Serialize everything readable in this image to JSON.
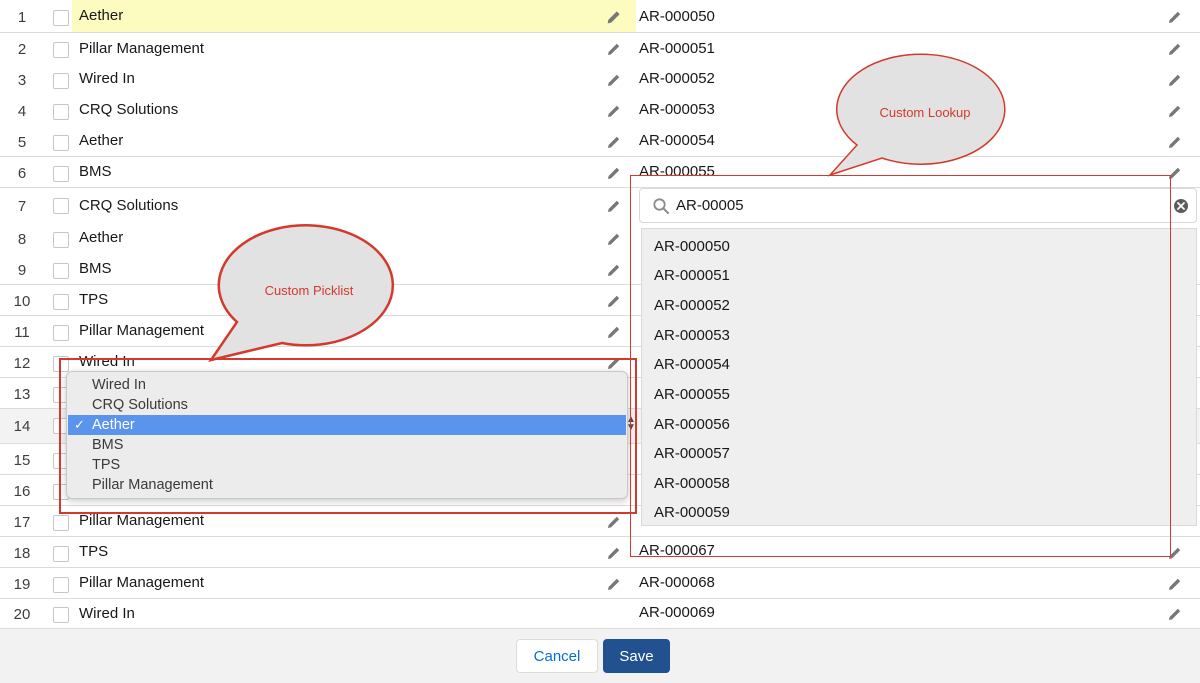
{
  "rows": [
    {
      "num": "1",
      "name": "Aether",
      "id": "AR-000050"
    },
    {
      "num": "2",
      "name": "Pillar Management",
      "id": "AR-000051"
    },
    {
      "num": "3",
      "name": "Wired In",
      "id": "AR-000052"
    },
    {
      "num": "4",
      "name": "CRQ Solutions",
      "id": "AR-000053"
    },
    {
      "num": "5",
      "name": "Aether",
      "id": "AR-000054"
    },
    {
      "num": "6",
      "name": "BMS",
      "id": "AR-000055"
    },
    {
      "num": "7",
      "name": "CRQ Solutions",
      "id": ""
    },
    {
      "num": "8",
      "name": "Aether",
      "id": ""
    },
    {
      "num": "9",
      "name": "BMS",
      "id": ""
    },
    {
      "num": "10",
      "name": "TPS",
      "id": ""
    },
    {
      "num": "11",
      "name": "Pillar Management",
      "id": ""
    },
    {
      "num": "12",
      "name": "Wired In",
      "id": ""
    },
    {
      "num": "13",
      "name": "",
      "id": ""
    },
    {
      "num": "14",
      "name": "",
      "id": ""
    },
    {
      "num": "15",
      "name": "",
      "id": ""
    },
    {
      "num": "16",
      "name": "",
      "id": ""
    },
    {
      "num": "17",
      "name": "Pillar Management",
      "id": ""
    },
    {
      "num": "18",
      "name": "TPS",
      "id": "AR-000067"
    },
    {
      "num": "19",
      "name": "Pillar Management",
      "id": "AR-000068"
    },
    {
      "num": "20",
      "name": "Wired In",
      "id": "AR-000069"
    }
  ],
  "picklist": {
    "options": [
      "Wired In",
      "CRQ Solutions",
      "Aether",
      "BMS",
      "TPS",
      "Pillar Management"
    ],
    "selected": "Aether",
    "check_glyph": "✓"
  },
  "lookup": {
    "value": "AR-00005",
    "results": [
      "AR-000050",
      "AR-000051",
      "AR-000052",
      "AR-000053",
      "AR-000054",
      "AR-000055",
      "AR-000056",
      "AR-000057",
      "AR-000058",
      "AR-000059"
    ]
  },
  "annotations": {
    "picklist_label": "Custom Picklist",
    "lookup_label": "Custom Lookup",
    "accent_color": "#d3392c",
    "bubble_fill": "#e2e2e2"
  },
  "footer": {
    "cancel_label": "Cancel",
    "save_label": "Save"
  },
  "icons": {
    "edit": "pencil-icon",
    "search": "search-icon",
    "clear": "clear-icon"
  }
}
